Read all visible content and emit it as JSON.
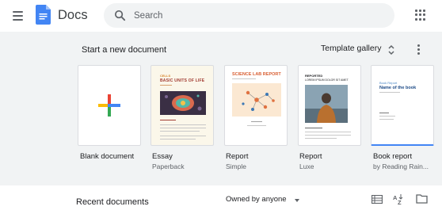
{
  "header": {
    "app_title": "Docs",
    "search_placeholder": "Search"
  },
  "templates_section": {
    "title": "Start a new document",
    "gallery_label": "Template gallery",
    "items": [
      {
        "name": "Blank document",
        "sub": ""
      },
      {
        "name": "Essay",
        "sub": "Paperback",
        "thumb_label": "CELLS",
        "thumb_title": "BASIC UNITS OF LIFE"
      },
      {
        "name": "Report",
        "sub": "Simple",
        "thumb_title": "SCIENCE LAB REPORT"
      },
      {
        "name": "Report",
        "sub": "Luxe",
        "thumb_label": "REPORTED",
        "thumb_title": "LOREM IPSUM DOLOR SIT AMET"
      },
      {
        "name": "Book report",
        "sub": "by Reading Rain...",
        "thumb_label": "Book Report",
        "thumb_title": "Name of the book"
      }
    ]
  },
  "recent_section": {
    "title": "Recent documents",
    "owner_filter": "Owned by anyone"
  },
  "colors": {
    "header_bg": "#ffffff",
    "template_bg": "#f1f3f4",
    "docs_blue": "#4285f4",
    "selected_border": "#4285f4"
  },
  "icons": [
    "menu-icon",
    "docs-logo-icon",
    "search-icon",
    "apps-grid-icon",
    "unfold-icon",
    "more-vert-icon",
    "plus-icon",
    "dropdown-arrow-icon",
    "list-view-icon",
    "sort-az-icon",
    "folder-icon"
  ]
}
